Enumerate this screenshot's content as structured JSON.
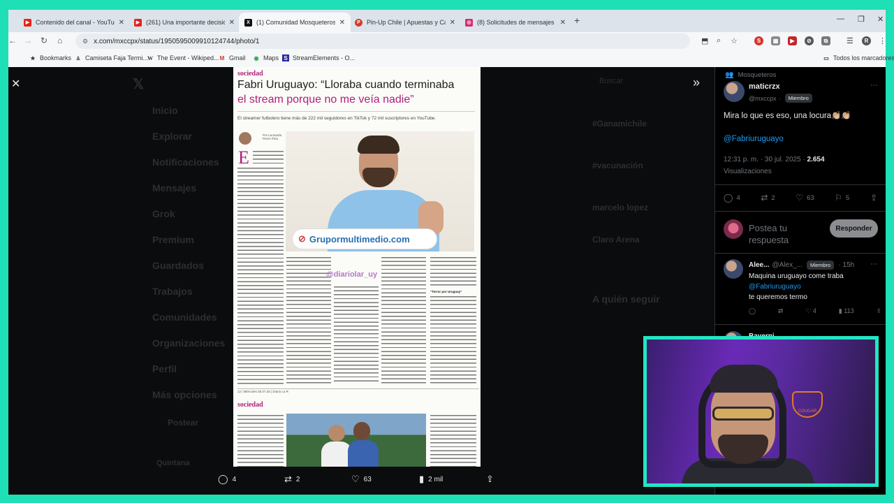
{
  "browser": {
    "tabs": [
      {
        "title": "Contenido del canal - YouTube",
        "favicon_color": "#e62117",
        "active": false
      },
      {
        "title": "(261) Una importante decisión",
        "favicon_color": "#e62117",
        "active": false
      },
      {
        "title": "(1) Comunidad Mosqueteros",
        "favicon_color": "#111111",
        "active": true
      },
      {
        "title": "Pin-Up Chile | Apuestas y Casino",
        "favicon_color": "#d23c2a",
        "active": false
      },
      {
        "title": "(8) Solicitudes de mensajes • C",
        "favicon_color": "#d62976",
        "active": false
      }
    ],
    "url": "x.com/mxccpx/status/1950595009910124744/photo/1",
    "bookmarks": [
      {
        "label": "Bookmarks",
        "icon": "star-icon"
      },
      {
        "label": "Camiseta Faja Termi...",
        "icon": "shirt-icon"
      },
      {
        "label": "The Event - Wikiped...",
        "icon": "wikipedia-icon"
      },
      {
        "label": "Gmail",
        "icon": "gmail-icon"
      },
      {
        "label": "Maps",
        "icon": "maps-icon"
      },
      {
        "label": "StreamElements - O...",
        "icon": "streamelements-icon"
      }
    ],
    "other_bookmarks": "Todos los marcadores"
  },
  "newspaper": {
    "section": "sociedad",
    "headline_1": "Fabri Uruguayo: “Lloraba cuando terminaba",
    "headline_2": "el stream porque no me veía nadie”",
    "dek": "El streamer futbolero tiene más de 222 mil seguidores en TikTok y 72 mil suscriptores en YouTube.",
    "byline": "Por Leonardo Perez Piria",
    "dropcap": "E",
    "watermark": "Grupormultimedio.com",
    "watermark2": "@diariolar_uy",
    "subhead": "“Terror por Uruguay”",
    "footer": "12 | Miércoles 30.07.25 | Diario La R",
    "section_2": "sociedad"
  },
  "tweet_actions": {
    "replies": "4",
    "reposts": "2",
    "likes": "63",
    "views": "2 mil"
  },
  "ghost_nav": [
    "Inicio",
    "Explorar",
    "Notificaciones",
    "Mensajes",
    "Grok",
    "Premium",
    "Guardados",
    "Trabajos",
    "Comunidades",
    "Organizaciones",
    "Perfil",
    "Más opciones",
    "Postear",
    "Quintana"
  ],
  "ghost_right": [
    "Buscar",
    "#Ganamichile",
    "#vacunación",
    "marcelo lopez",
    "Claro Arena",
    "A quién seguir",
    "Sigue"
  ],
  "sidebar": {
    "community": "Mosqueteros",
    "author_name": "maticrzx",
    "author_handle": "@mxccpx",
    "author_badge": "Miembro",
    "post_text": "Mira lo que es eso, una locura👏🏼👏🏼",
    "mention": "@Fabriuruguayo",
    "timestamp": "12:31 p. m. · 30 jul. 2025 · ",
    "view_count": "2.654",
    "views_label": "Visualizaciones",
    "stats": {
      "replies": "4",
      "reposts": "2",
      "likes": "63",
      "bookmarks": "5"
    },
    "reply_placeholder": "Postea tu respuesta",
    "reply_button": "Responder",
    "reply": {
      "name": "Alee...",
      "handle": "@Alex_...",
      "badge": "Miembro",
      "time": "15h",
      "text_line1": "Maquina uruguayo come traba",
      "mention": "@Fabriuruguayo",
      "text_line3": " te queremos termo",
      "stats": {
        "replies": "",
        "reposts": "",
        "likes": "4",
        "views": "113"
      }
    },
    "next_reply_name": "Bayerni"
  },
  "webcam": {
    "logo": "COUGAR"
  }
}
